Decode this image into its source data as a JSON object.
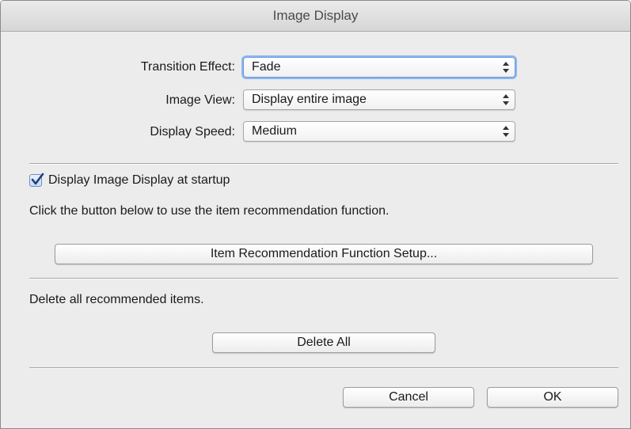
{
  "window": {
    "title": "Image Display"
  },
  "settings": {
    "transition_effect": {
      "label": "Transition Effect:",
      "value": "Fade"
    },
    "image_view": {
      "label": "Image View:",
      "value": "Display entire image"
    },
    "display_speed": {
      "label": "Display Speed:",
      "value": "Medium"
    }
  },
  "startup": {
    "checkbox_label": "Display Image Display at startup",
    "checked": true
  },
  "recommendation": {
    "info_text": "Click the button below to use the item recommendation function.",
    "setup_button": "Item Recommendation Function Setup..."
  },
  "delete": {
    "info_text": "Delete all recommended items.",
    "button": "Delete All"
  },
  "footer": {
    "cancel": "Cancel",
    "ok": "OK"
  },
  "colors": {
    "focus_ring": "#8cb6ee",
    "checkmark": "#1f3f7a"
  }
}
